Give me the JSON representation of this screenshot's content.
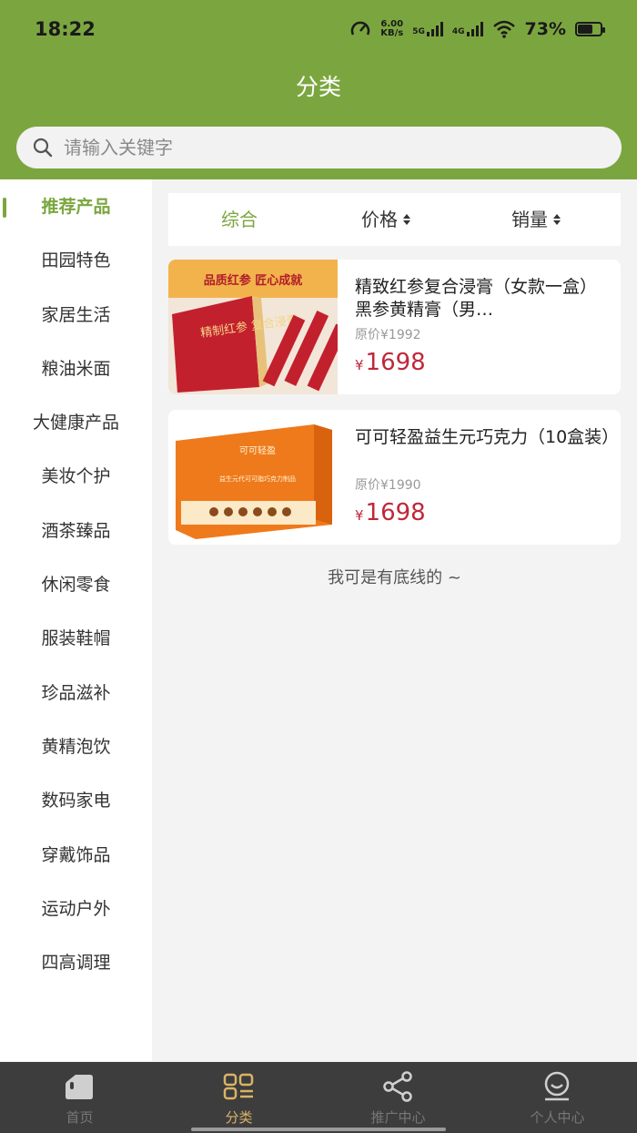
{
  "status": {
    "time": "18:22",
    "speed_top": "6.00",
    "speed_unit": "KB/s",
    "net1": "5G",
    "net2": "4G",
    "battery": "73%",
    "battery_level": 0.73
  },
  "header": {
    "title": "分类"
  },
  "search": {
    "placeholder": "请输入关键字"
  },
  "sidebar": {
    "items": [
      {
        "label": "推荐产品",
        "active": true
      },
      {
        "label": "田园特色"
      },
      {
        "label": "家居生活"
      },
      {
        "label": "粮油米面"
      },
      {
        "label": "大健康产品"
      },
      {
        "label": "美妆个护"
      },
      {
        "label": "酒茶臻品"
      },
      {
        "label": "休闲零食"
      },
      {
        "label": "服装鞋帽"
      },
      {
        "label": "珍品滋补"
      },
      {
        "label": "黄精泡饮"
      },
      {
        "label": "数码家电"
      },
      {
        "label": "穿戴饰品"
      },
      {
        "label": "运动户外"
      },
      {
        "label": "四高调理"
      }
    ]
  },
  "sort": {
    "overall": "综合",
    "price": "价格",
    "sales": "销量"
  },
  "products": [
    {
      "name": "精致红参复合浸膏（女款一盒）黑参黄精膏（男…",
      "orig_price": "原价¥1992",
      "currency": "¥",
      "price": "1698",
      "image_banner": "品质红参 匠心成就",
      "image_text": "精制红参 复合浸膏"
    },
    {
      "name": "可可轻盈益生元巧克力（10盒装）",
      "orig_price": "原价¥1990",
      "currency": "¥",
      "price": "1698",
      "image_brand": "可可轻盈",
      "image_text": "益生元代可可脂巧克力制品"
    }
  ],
  "end_text": "我可是有底线的 ~",
  "tabbar": {
    "items": [
      {
        "label": "首页",
        "icon": "home-icon"
      },
      {
        "label": "分类",
        "icon": "category-icon",
        "active": true
      },
      {
        "label": "推广中心",
        "icon": "share-icon"
      },
      {
        "label": "个人中心",
        "icon": "profile-icon"
      }
    ]
  },
  "colors": {
    "accent": "#7ba63f",
    "price": "#c0273a",
    "tab_active": "#d9b366"
  }
}
